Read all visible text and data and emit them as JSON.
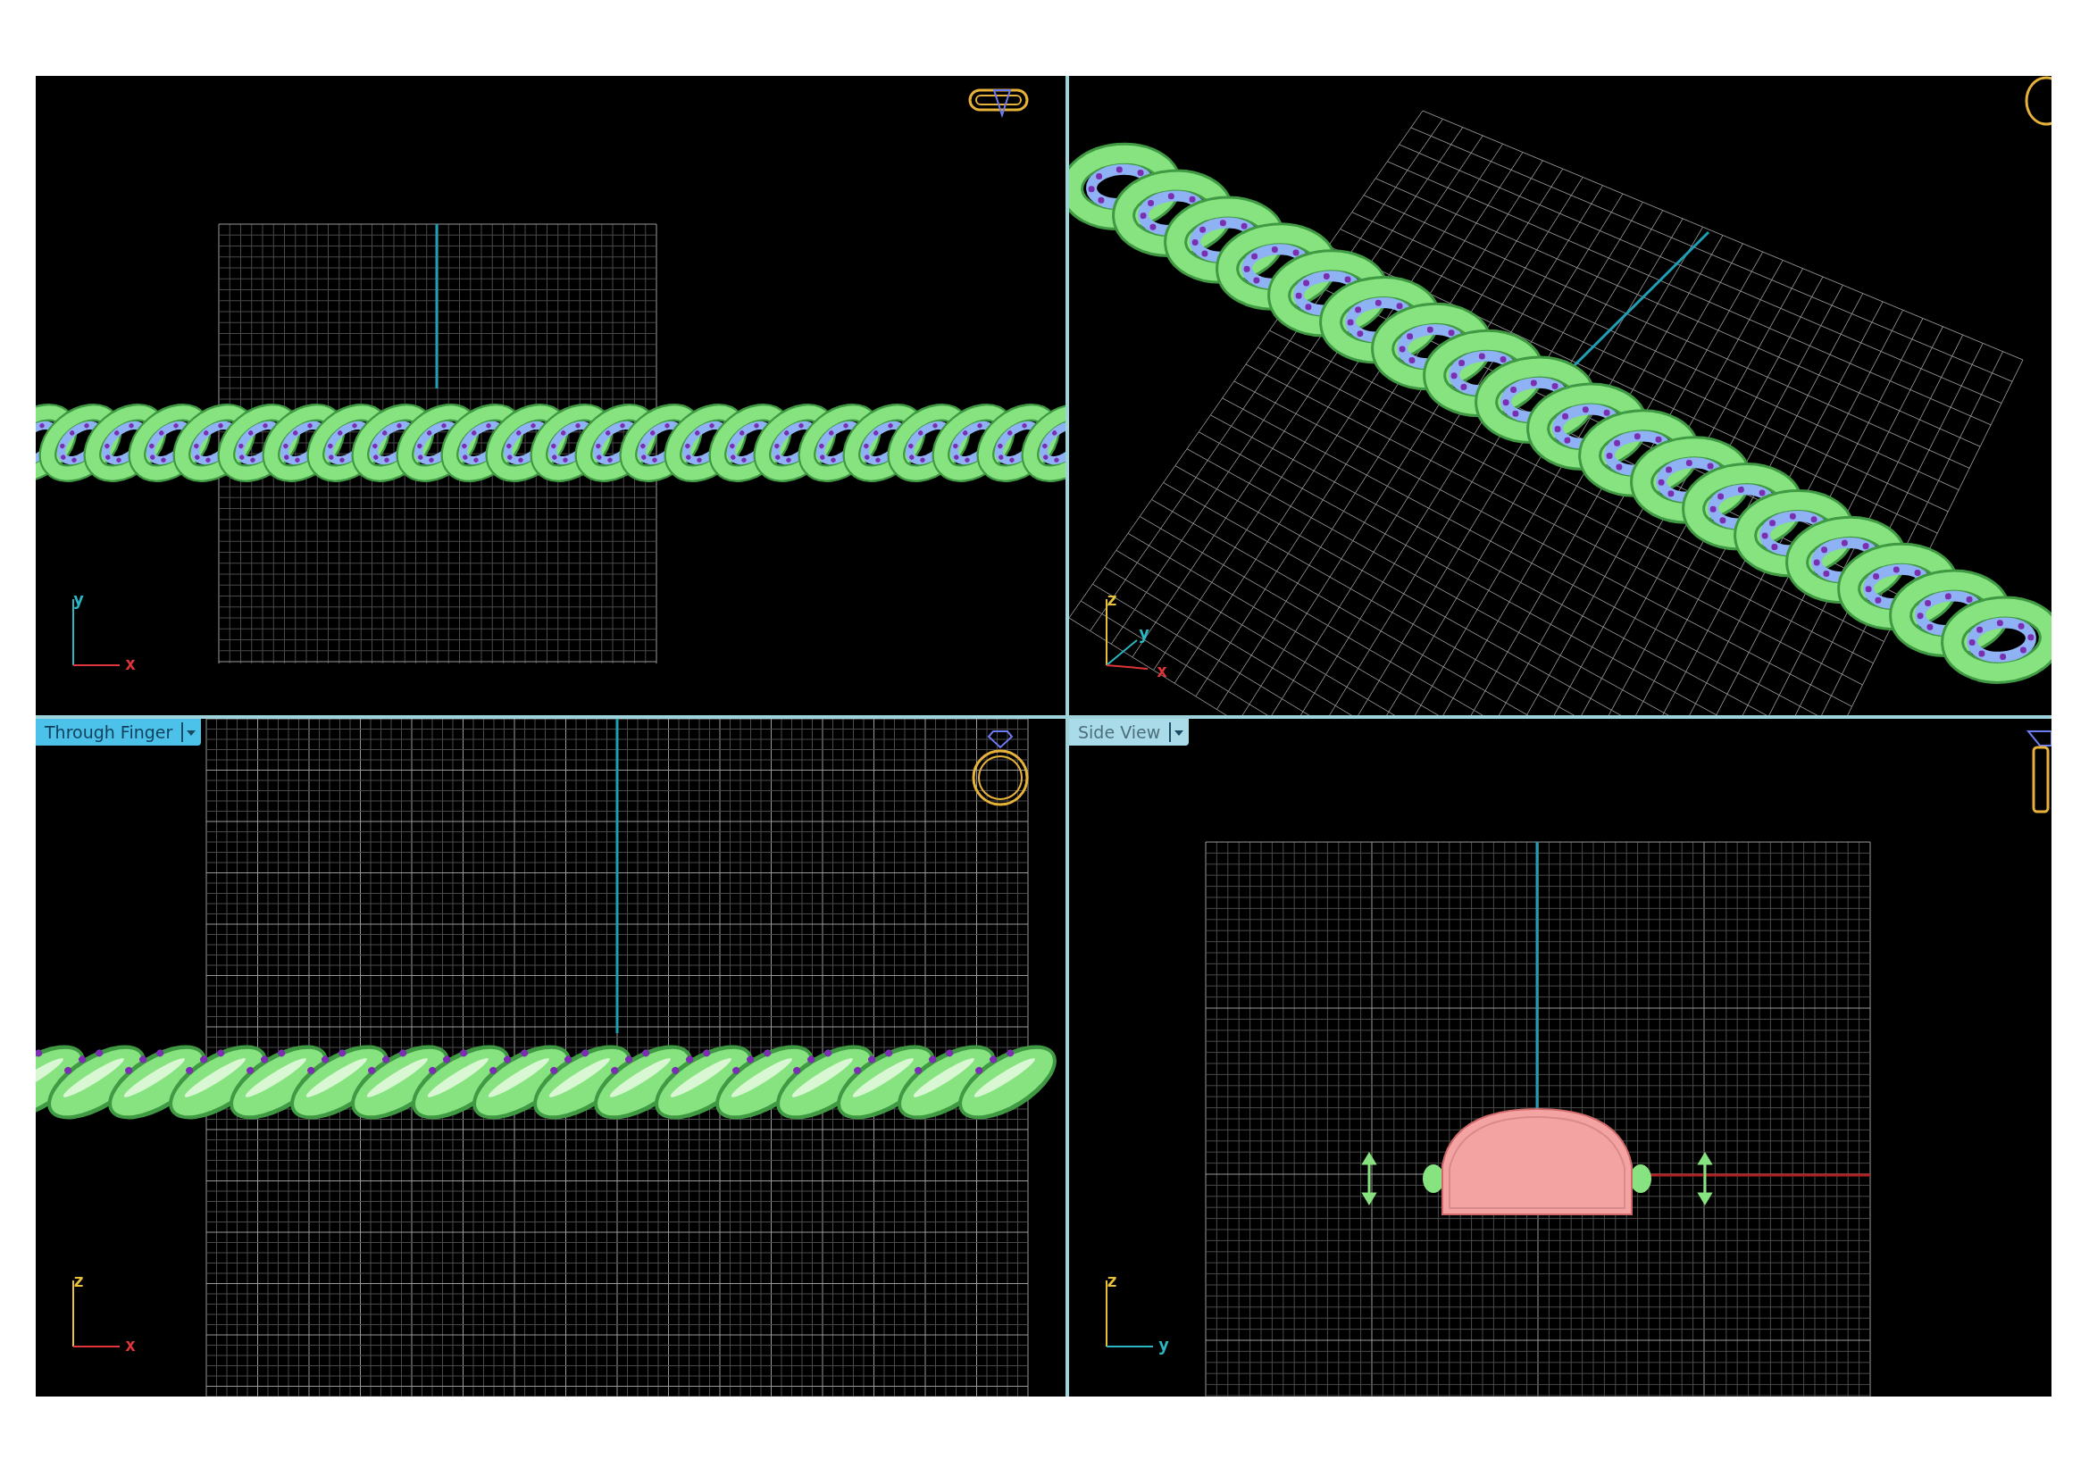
{
  "viewports": [
    {
      "kind": "top",
      "axes": [
        {
          "kind": "vertical",
          "label": "y",
          "color": "#2bb8c4"
        },
        {
          "kind": "horizontal",
          "label": "x",
          "color": "#e0353a"
        }
      ]
    },
    {
      "kind": "perspective",
      "axes": [
        {
          "kind": "vertical",
          "label": "z",
          "color": "#e8c23a"
        },
        {
          "kind": "depth",
          "label": "y",
          "color": "#2bb8c4"
        },
        {
          "kind": "down",
          "label": "x",
          "color": "#e0353a"
        }
      ]
    },
    {
      "kind": "front",
      "view_menu": {
        "label": "Through Finger",
        "active": true
      },
      "axes": [
        {
          "kind": "vertical",
          "label": "z",
          "color": "#e8c23a"
        },
        {
          "kind": "horizontal",
          "label": "x",
          "color": "#e0353a"
        }
      ]
    },
    {
      "kind": "side",
      "view_menu": {
        "label": "Side View",
        "active": false
      },
      "axes": [
        {
          "kind": "vertical",
          "label": "z",
          "color": "#e8c23a"
        },
        {
          "kind": "horizontal",
          "label": "y",
          "color": "#2bb8c4"
        }
      ]
    }
  ]
}
